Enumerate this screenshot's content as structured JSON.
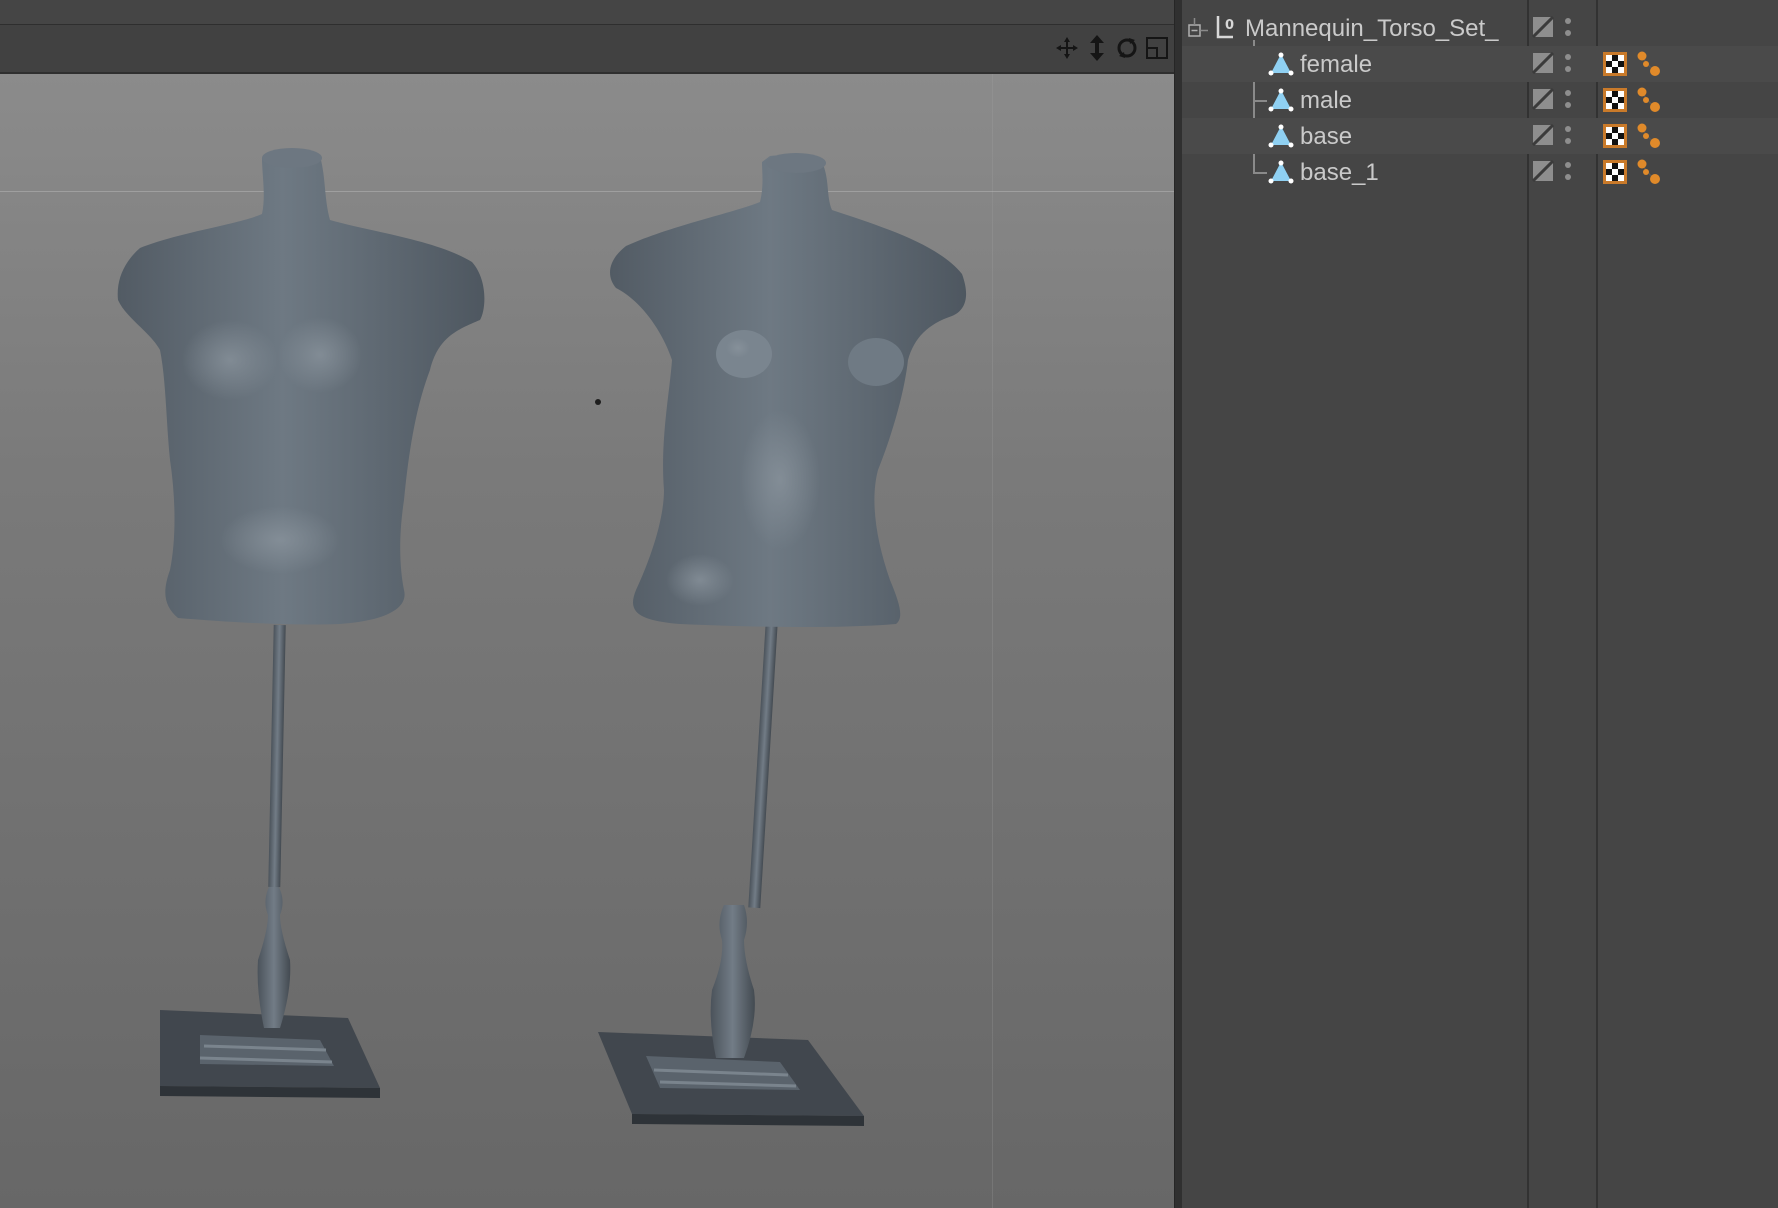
{
  "viewport": {
    "nav_icons": [
      "move-view-icon",
      "zoom-view-icon",
      "rotate-view-icon",
      "maximize-view-icon"
    ],
    "scene_objects": [
      "male-mannequin",
      "female-mannequin"
    ],
    "colors": {
      "background_top": "#8b8b8b",
      "background_bottom": "#676767",
      "mannequin": "#5f6871"
    }
  },
  "object_manager": {
    "objects": [
      {
        "name": "Mannequin_Torso_Set_",
        "type": "null",
        "icon": "null-object-icon",
        "expander": "collapse-icon",
        "tags": []
      },
      {
        "name": "female",
        "type": "polygon",
        "icon": "polygon-object-icon",
        "tags": [
          "texture-tag-icon",
          "phong-tag-icon"
        ]
      },
      {
        "name": "male",
        "type": "polygon",
        "icon": "polygon-object-icon",
        "tags": [
          "texture-tag-icon",
          "phong-tag-icon"
        ]
      },
      {
        "name": "base",
        "type": "polygon",
        "icon": "polygon-object-icon",
        "tags": [
          "texture-tag-icon",
          "phong-tag-icon"
        ]
      },
      {
        "name": "base_1",
        "type": "polygon",
        "icon": "polygon-object-icon",
        "tags": [
          "texture-tag-icon",
          "phong-tag-icon"
        ]
      }
    ],
    "colors": {
      "text": "#cacaca",
      "polygon_icon": "#8fd0f2",
      "phong_tag": "#e08a2a"
    }
  }
}
